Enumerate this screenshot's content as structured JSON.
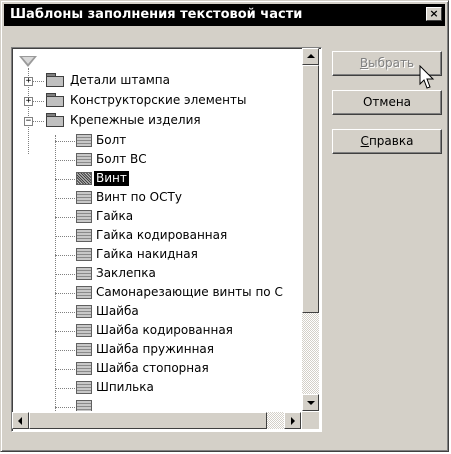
{
  "window": {
    "title": "Шаблоны заполнения текстовой части",
    "close_glyph": "×"
  },
  "tree": {
    "folders": [
      {
        "label": "Детали штампа",
        "expander": "+"
      },
      {
        "label": "Конструкторские элементы",
        "expander": "+"
      },
      {
        "label": "Крепежные изделия",
        "expander": "−"
      }
    ],
    "items": [
      {
        "label": "Болт"
      },
      {
        "label": "Болт ВС"
      },
      {
        "label": "Винт",
        "selected": true
      },
      {
        "label": "Винт по ОСТу"
      },
      {
        "label": "Гайка"
      },
      {
        "label": "Гайка кодированная"
      },
      {
        "label": "Гайка накидная"
      },
      {
        "label": "Заклепка"
      },
      {
        "label": "Самонарезающие винты по С"
      },
      {
        "label": "Шайба"
      },
      {
        "label": "Шайба кодированная"
      },
      {
        "label": "Шайба пружинная"
      },
      {
        "label": "Шайба стопорная"
      },
      {
        "label": "Шпилька"
      }
    ]
  },
  "buttons": {
    "select": {
      "label_hotkey": "В",
      "label_rest": "ыбрать",
      "disabled": true
    },
    "cancel": {
      "label": "Отмена"
    },
    "help": {
      "label_hotkey": "С",
      "label_rest": "правка"
    }
  },
  "colors": {
    "face": "#d4d0c8",
    "title_bg": "#000000",
    "selection": "#000000"
  }
}
